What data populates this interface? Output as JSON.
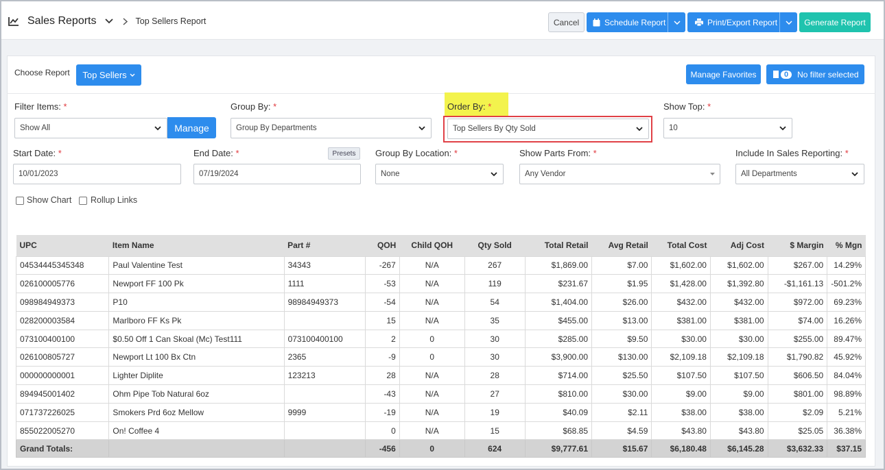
{
  "header": {
    "title": "Sales Reports",
    "subtitle": "Top Sellers Report",
    "cancel": "Cancel",
    "schedule": "Schedule Report",
    "print_export": "Print/Export Report",
    "generate": "Generate Report"
  },
  "toolbar": {
    "choose_report_label": "Choose Report",
    "report_selected": "Top Sellers",
    "manage_favorites": "Manage Favorites",
    "filter_count": "0",
    "no_filter": "No filter selected"
  },
  "filters": {
    "filter_items_label": "Filter Items:",
    "filter_items_value": "Show All",
    "manage_button": "Manage",
    "group_by_label": "Group By:",
    "group_by_value": "Group By Departments",
    "order_by_label": "Order By:",
    "order_by_value": "Top Sellers By Qty Sold",
    "show_top_label": "Show Top:",
    "show_top_value": "10",
    "start_date_label": "Start Date:",
    "start_date_value": "10/01/2023",
    "end_date_label": "End Date:",
    "end_date_value": "07/19/2024",
    "presets": "Presets",
    "group_by_location_label": "Group By Location:",
    "group_by_location_value": "None",
    "show_parts_from_label": "Show Parts From:",
    "show_parts_from_value": "Any Vendor",
    "include_label": "Include In Sales Reporting:",
    "include_value": "All Departments",
    "required_mark": "*",
    "show_chart": "Show Chart",
    "rollup_links": "Rollup Links"
  },
  "table": {
    "columns": [
      "UPC",
      "Item Name",
      "Part #",
      "QOH",
      "Child QOH",
      "Qty Sold",
      "Total Retail",
      "Avg Retail",
      "Total Cost",
      "Adj Cost",
      "$ Margin",
      "% Mgn"
    ],
    "rows": [
      [
        "04534445345348",
        "Paul Valentine Test",
        "34343",
        "-267",
        "N/A",
        "267",
        "$1,869.00",
        "$7.00",
        "$1,602.00",
        "$1,602.00",
        "$267.00",
        "14.29%"
      ],
      [
        "026100005776",
        "Newport FF 100 Pk",
        "1111",
        "-53",
        "N/A",
        "119",
        "$231.67",
        "$1.95",
        "$1,428.00",
        "$1,392.80",
        "-$1,161.13",
        "-501.2%"
      ],
      [
        "098984949373",
        "P10",
        "98984949373",
        "-54",
        "N/A",
        "54",
        "$1,404.00",
        "$26.00",
        "$432.00",
        "$432.00",
        "$972.00",
        "69.23%"
      ],
      [
        "028200003584",
        "Marlboro FF Ks Pk",
        "",
        "15",
        "N/A",
        "35",
        "$455.00",
        "$13.00",
        "$381.00",
        "$381.00",
        "$74.00",
        "16.26%"
      ],
      [
        "073100400100",
        "$0.50 Off 1 Can Skoal (Mc) Test111",
        "073100400100",
        "2",
        "0",
        "30",
        "$285.00",
        "$9.50",
        "$30.00",
        "$30.00",
        "$255.00",
        "89.47%"
      ],
      [
        "026100805727",
        "Newport Lt 100 Bx Ctn",
        "2365",
        "-9",
        "0",
        "30",
        "$3,900.00",
        "$130.00",
        "$2,109.18",
        "$2,109.18",
        "$1,790.82",
        "45.92%"
      ],
      [
        "000000000001",
        "Lighter Diplite",
        "123213",
        "28",
        "N/A",
        "28",
        "$714.00",
        "$25.50",
        "$107.50",
        "$107.50",
        "$606.50",
        "84.04%"
      ],
      [
        "894945001402",
        "Ohm Pipe Tob Natural 6oz",
        "",
        "-43",
        "N/A",
        "27",
        "$810.00",
        "$30.00",
        "$9.00",
        "$9.00",
        "$801.00",
        "98.89%"
      ],
      [
        "071737226025",
        "Smokers Prd 6oz Mellow",
        "9999",
        "-19",
        "N/A",
        "19",
        "$40.09",
        "$2.11",
        "$38.00",
        "$38.00",
        "$2.09",
        "5.21%"
      ],
      [
        "855022005270",
        "On! Coffee 4",
        "",
        "0",
        "N/A",
        "15",
        "$68.85",
        "$4.59",
        "$43.80",
        "$43.80",
        "$25.05",
        "36.38%"
      ]
    ],
    "totals": [
      "Grand Totals:",
      "",
      "",
      "-456",
      "0",
      "624",
      "$9,777.61",
      "$15.67",
      "$6,180.48",
      "$6,145.28",
      "$3,632.33",
      "$37.15"
    ]
  }
}
